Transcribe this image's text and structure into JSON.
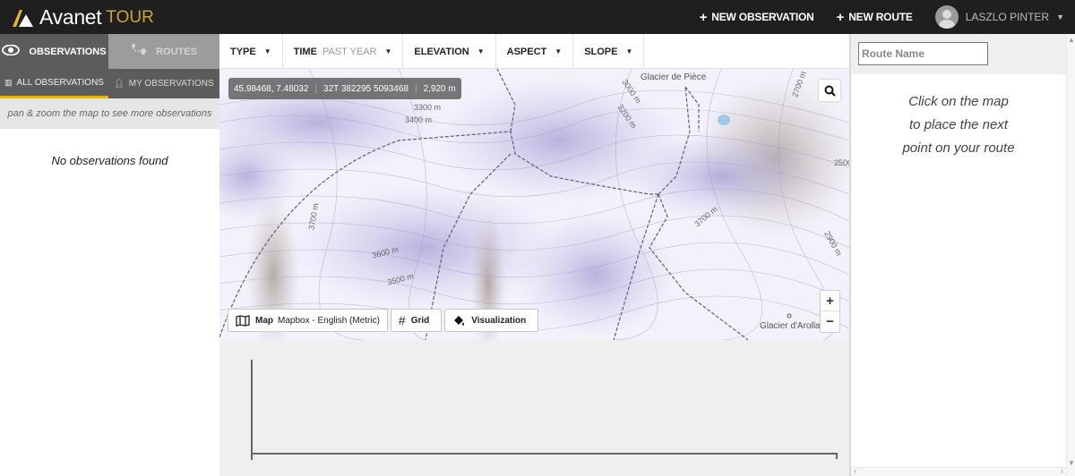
{
  "header": {
    "brand": "Avanet",
    "product": "TOUR",
    "new_observation": "NEW OBSERVATION",
    "new_route": "NEW ROUTE",
    "user_name": "LASZLO PINTER",
    "colors": {
      "bar": "#1f1f1f",
      "accent": "#c9a53a"
    }
  },
  "sidebar": {
    "tabs": [
      {
        "label": "OBSERVATIONS",
        "icon": "eye-icon",
        "active": true
      },
      {
        "label": "ROUTES",
        "icon": "route-icon",
        "active": false
      }
    ],
    "subtabs": [
      {
        "label": "ALL OBSERVATIONS",
        "icon": "map-icon",
        "active": true
      },
      {
        "label": "MY OBSERVATIONS",
        "icon": "user-icon",
        "active": false
      }
    ],
    "hint": "pan & zoom the map to see more observations",
    "empty_message": "No observations found"
  },
  "filters": [
    {
      "label": "TYPE",
      "value": ""
    },
    {
      "label": "TIME",
      "value": "PAST YEAR"
    },
    {
      "label": "ELEVATION",
      "value": ""
    },
    {
      "label": "ASPECT",
      "value": ""
    },
    {
      "label": "SLOPE",
      "value": ""
    }
  ],
  "map": {
    "coords": "45.98468, 7.48032",
    "utm": "32T 382295 5093468",
    "elevation": "2,920 m",
    "labels": [
      "Glacier de Pièce",
      "Glacier d'Arolla",
      "3300 m",
      "3400 m",
      "3600 m",
      "3500 m",
      "3700 m",
      "3000 m",
      "3200 m",
      "2900 m",
      "2700 m",
      "2500"
    ],
    "zoom_in": "+",
    "zoom_out": "−",
    "tools": {
      "map_label": "Map",
      "map_value": "Mapbox - English (Metric)",
      "grid_label": "Grid",
      "visualization_label": "Visualization"
    }
  },
  "route_panel": {
    "name_placeholder": "Route Name",
    "message_line1": "Click on the map",
    "message_line2": "to place the next",
    "message_line3": "point on your route"
  }
}
